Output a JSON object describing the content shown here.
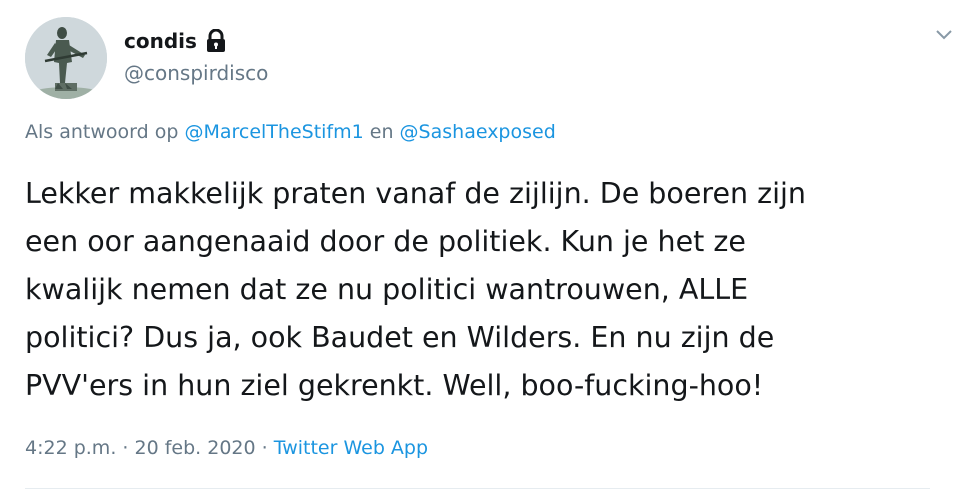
{
  "user": {
    "display_name": "condis",
    "handle": "@conspirdisco",
    "avatar_icon": "statue-soldier-avatar",
    "protected_icon": "lock-icon"
  },
  "reply": {
    "prefix": "Als antwoord op",
    "mention1": "@MarcelTheStifm1",
    "joiner": "en",
    "mention2": "@Sashaexposed"
  },
  "tweet": {
    "lines": [
      "Lekker makkelijk praten vanaf de zijlijn. De boeren zijn",
      "een oor aangenaaid door de politiek. Kun je het ze",
      "kwalijk nemen dat ze nu politici wantrouwen, ALLE",
      "politici? Dus ja, ook Baudet en Wilders. En nu zijn de",
      "PVV'ers in hun ziel gekrenkt. Well, boo-fucking-hoo!"
    ]
  },
  "meta": {
    "time": "4:22 p.m.",
    "separator": "·",
    "date": "20 feb. 2020",
    "source": "Twitter Web App"
  },
  "colors": {
    "text": "#14171a",
    "secondary": "#657786",
    "link": "#1b95e0",
    "divider": "#e6ecf0"
  }
}
